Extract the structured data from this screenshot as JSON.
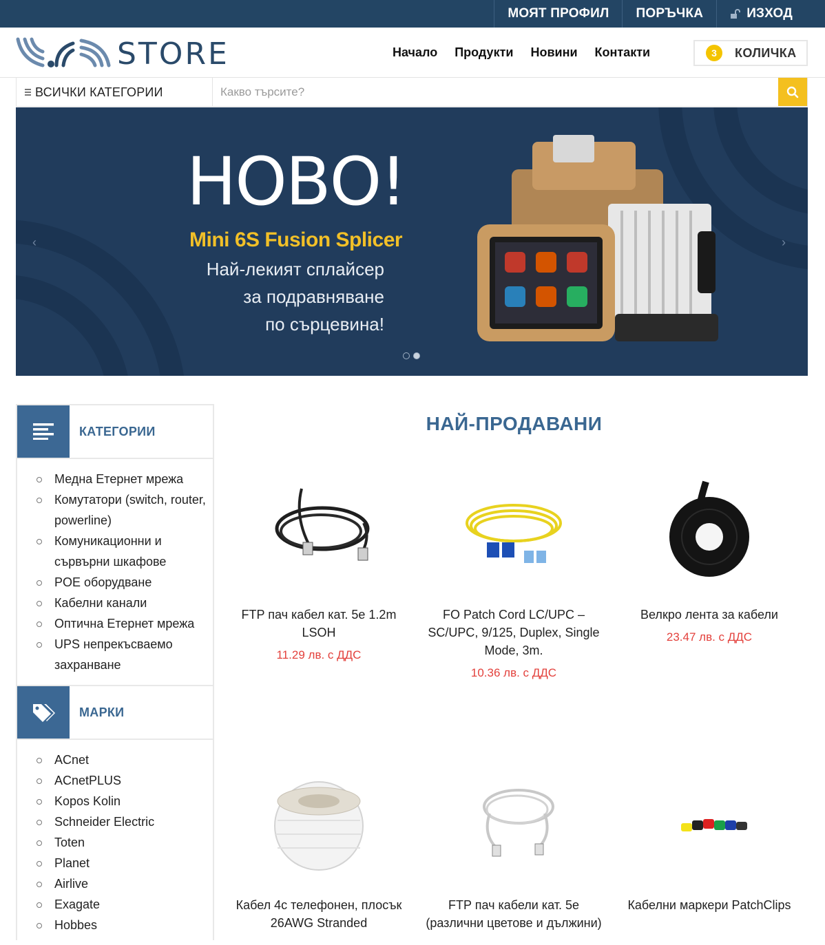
{
  "topbar": {
    "profile": "МОЯТ ПРОФИЛ",
    "order": "ПОРЪЧКА",
    "logout": "ИЗХОД"
  },
  "brand": {
    "logo_text": "STORE"
  },
  "nav": {
    "home": "Начало",
    "products": "Продукти",
    "news": "Новини",
    "contacts": "Контакти"
  },
  "cart": {
    "count": "3",
    "label": "КОЛИЧКА"
  },
  "search": {
    "category": "ВСИЧКИ КАТЕГОРИИ",
    "placeholder": "Какво търсите?"
  },
  "banner": {
    "title": "НОВО!",
    "subtitle": "Mini 6S Fusion Splicer",
    "line1": "Най-лекият сплайсер",
    "line2": "за подравняване",
    "line3": "по сърцевина!"
  },
  "sidebar": {
    "categories_title": "КАТЕГОРИИ",
    "categories": [
      "Медна Етернет мрежа",
      "Комутатори (switch, router, powerline)",
      "Комуникационни и сървърни шкафове",
      "POE оборудване",
      "Кабелни канали",
      "Оптична Етернет мрежа",
      "UPS непрекъсваемо захранване"
    ],
    "brands_title": "МАРКИ",
    "brands": [
      "ACnet",
      "ACnetPLUS",
      "Kopos Kolin",
      "Schneider Electric",
      "Toten",
      "Planet",
      "Airlive",
      "Exagate",
      "Hobbes"
    ]
  },
  "bestsellers": {
    "title": "НАЙ-ПРОДАВАНИ",
    "products": [
      {
        "name": "FTP пач кабел кат. 5е 1.2m LSOH",
        "price": "11.29 лв. с ДДС"
      },
      {
        "name": "FO Patch Cord LC/UPC – SC/UPC, 9/125, Duplex, Single Mode, 3m.",
        "price": "10.36 лв. с ДДС"
      },
      {
        "name": "Велкро лента за кабели",
        "price": "23.47 лв. с ДДС"
      },
      {
        "name": "Кабел 4с телефонен, плосък 26AWG Stranded",
        "price": ""
      },
      {
        "name": "FTP пач кабели кат. 5е (различни цветове и дължини)",
        "price": ""
      },
      {
        "name": "Кабелни маркери PatchClips",
        "price": ""
      }
    ]
  },
  "colors": {
    "navy": "#234564",
    "accent_blue": "#3c6894",
    "yellow": "#f4c01f",
    "price_red": "#e3413c"
  }
}
